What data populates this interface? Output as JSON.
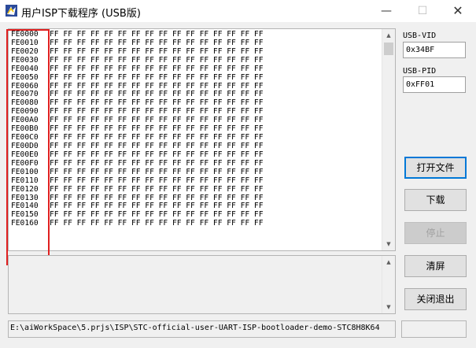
{
  "window": {
    "title": "用户ISP下载程序 (USB版)",
    "minimize_glyph": "—",
    "maximize_glyph": "☐",
    "close_glyph": "✕"
  },
  "hex": {
    "data": "FF FF FF FF FF FF FF FF FF FF FF FF FF FF FF FF",
    "addresses": [
      "FE0000",
      "FE0010",
      "FE0020",
      "FE0030",
      "FE0040",
      "FE0050",
      "FE0060",
      "FE0070",
      "FE0080",
      "FE0090",
      "FE00A0",
      "FE00B0",
      "FE00C0",
      "FE00D0",
      "FE00E0",
      "FE00F0",
      "FE0100",
      "FE0110",
      "FE0120",
      "FE0130",
      "FE0140",
      "FE0150",
      "FE0160"
    ]
  },
  "usb": {
    "vid_label": "USB-VID",
    "vid_value": "0x34BF",
    "pid_label": "USB-PID",
    "pid_value": "0xFF01"
  },
  "buttons": {
    "open_file": "打开文件",
    "download": "下载",
    "stop": "停止",
    "clear": "清屏",
    "close_exit": "关闭退出"
  },
  "status": {
    "path": "E:\\aiWorkSpace\\5.prjs\\ISP\\STC-official-user-UART-ISP-bootloader-demo-STC8H8K64"
  },
  "icons": {
    "app": "app-icon",
    "scroll_up": "scroll-up-arrow-icon",
    "scroll_down": "scroll-down-arrow-icon"
  },
  "colors": {
    "highlight_box": "#e02020",
    "focus_border": "#0078d7"
  }
}
